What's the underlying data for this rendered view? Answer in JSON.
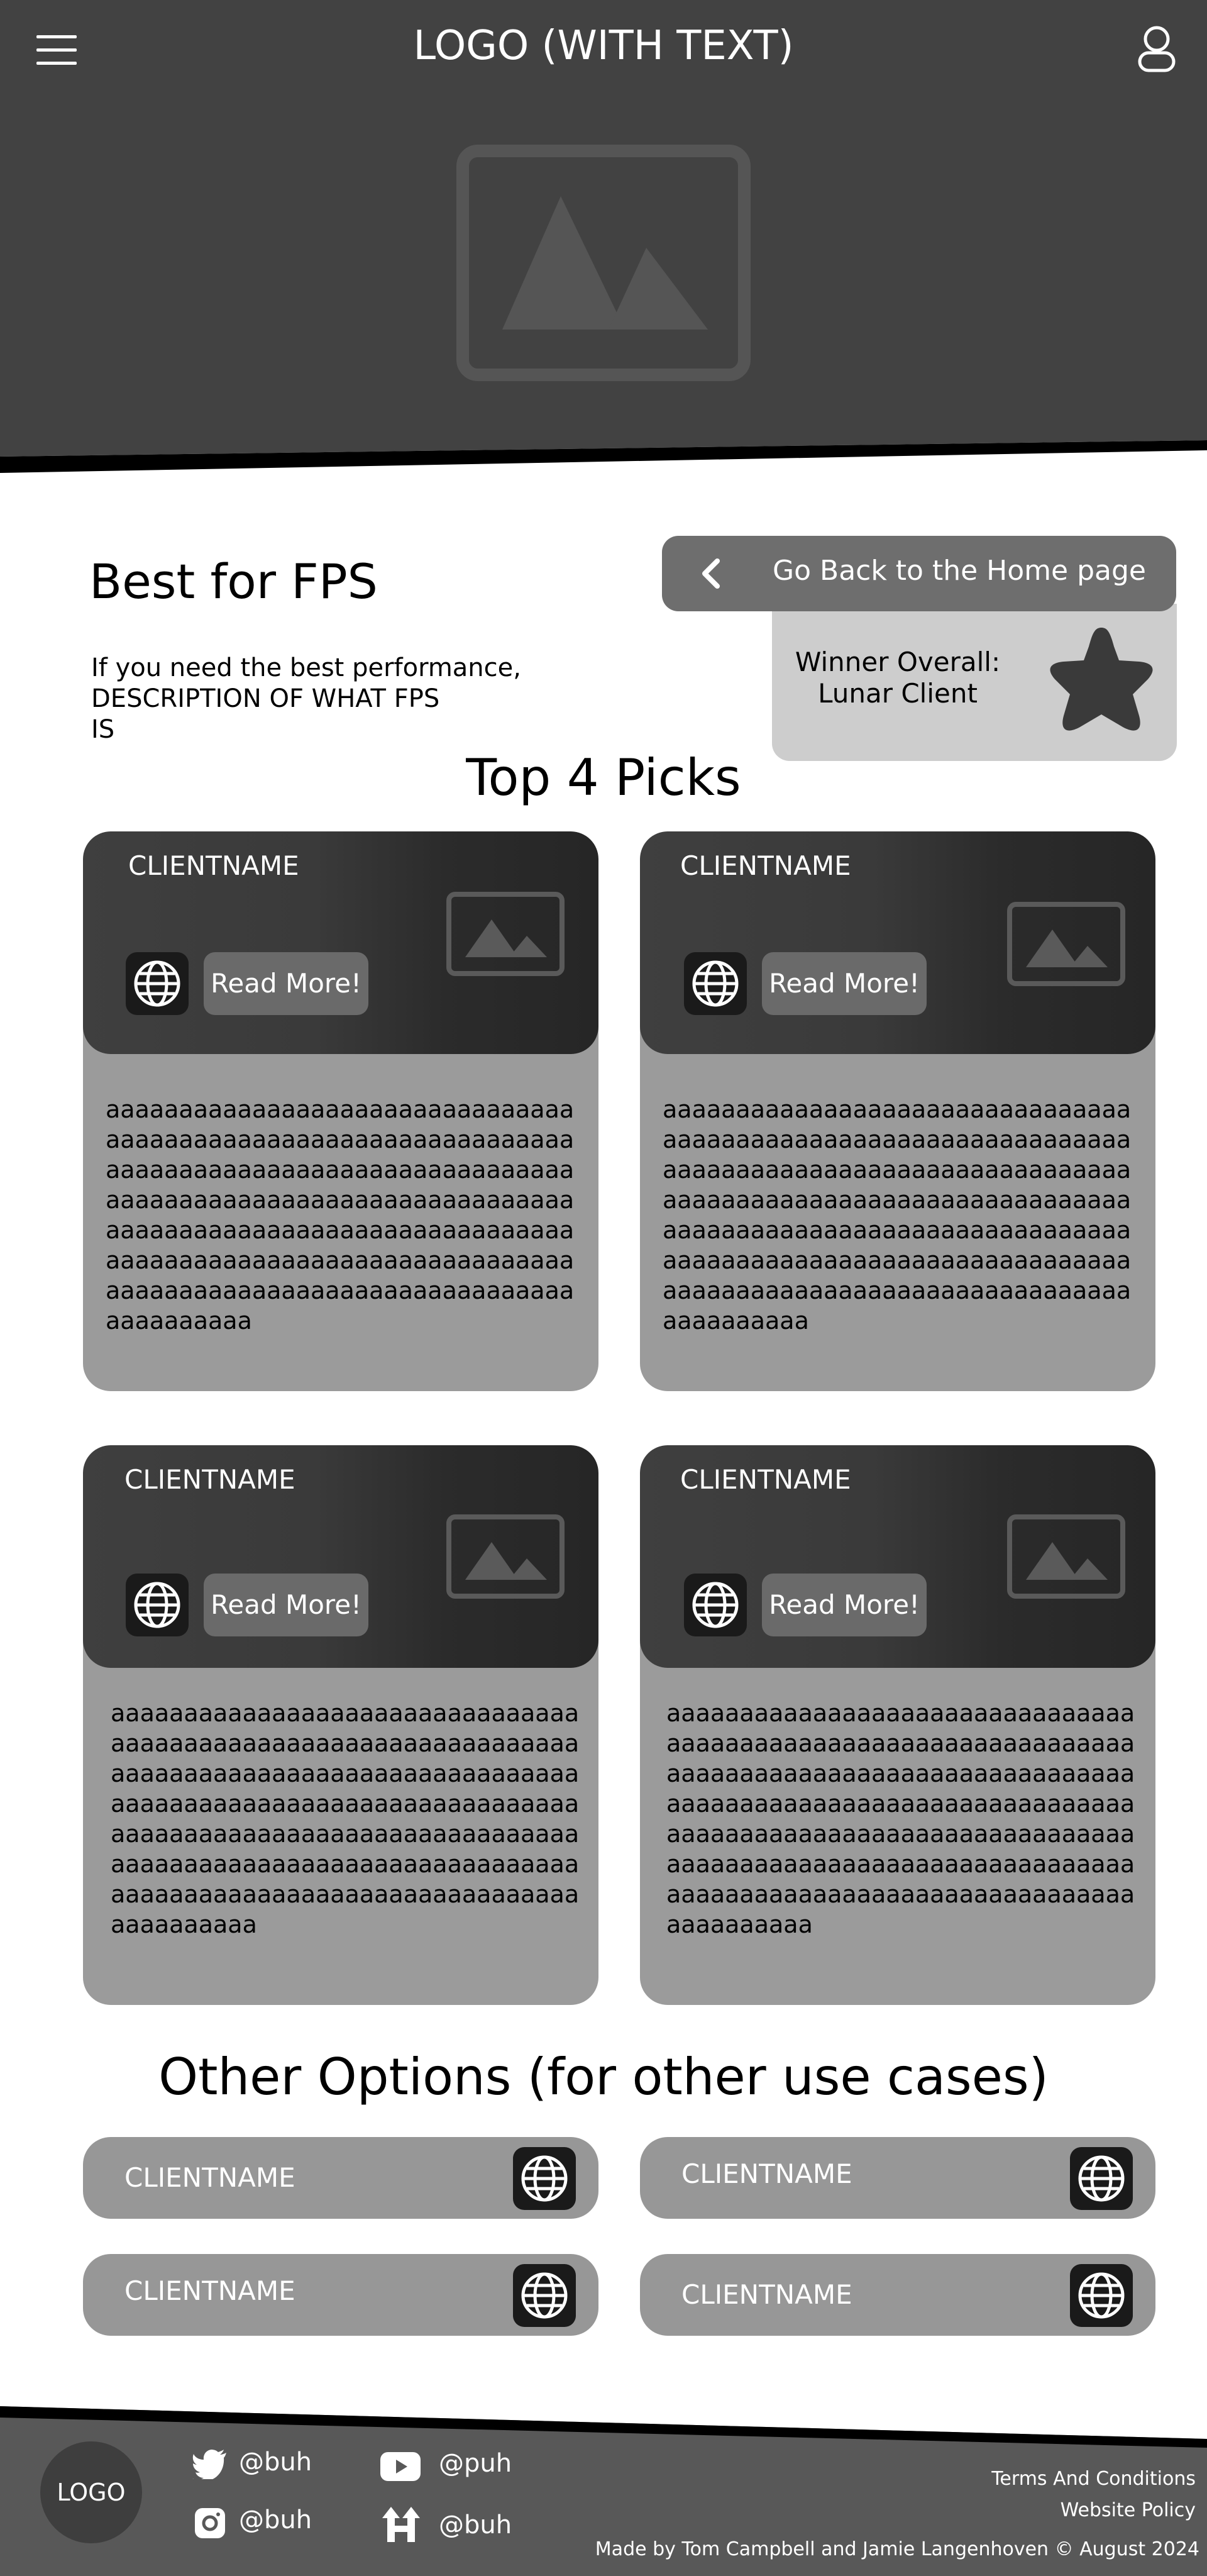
{
  "header": {
    "logo": "LOGO (WITH TEXT)",
    "menu_icon": "hamburger-menu-icon",
    "account_icon": "user-icon",
    "hero_image_icon": "image-placeholder-icon"
  },
  "intro": {
    "title": "Best for FPS",
    "description": "If you need the best performance,\nDESCRIPTION OF WHAT FPS\nIS",
    "back_button": "Go Back to the Home page",
    "back_icon": "chevron-left-icon",
    "winner_text": "Winner Overall:\nLunar Client",
    "winner_icon": "star-icon"
  },
  "top_picks": {
    "title": "Top 4 Picks",
    "cards": [
      {
        "name": "CLIENTNAME",
        "read_more": "Read More!",
        "body": "aaaaaaaaaaaaaaaaaaaaaaaaaaaaaaaaaaaaaaaaaaaaaaaaaaaaaaaaaaaaaaaaaaaaaaaaaaaaaaaaaaaaaaaaaaaaaaaaaaaaaaaaaaaaaaaaaaaaaaaaaaaaaaaaaaaaaaaaaaaaaaaaaaaaaaaaaaaaaaaaaaaaaaaaaaaaaaaaaaaaaaaaaaaaaaaaaaaaaaaaaaaaaaaaaaaaaaaaaaaaaaaaaaaaaaaaaa"
      },
      {
        "name": "CLIENTNAME",
        "read_more": "Read More!",
        "body": "aaaaaaaaaaaaaaaaaaaaaaaaaaaaaaaaaaaaaaaaaaaaaaaaaaaaaaaaaaaaaaaaaaaaaaaaaaaaaaaaaaaaaaaaaaaaaaaaaaaaaaaaaaaaaaaaaaaaaaaaaaaaaaaaaaaaaaaaaaaaaaaaaaaaaaaaaaaaaaaaaaaaaaaaaaaaaaaaaaaaaaaaaaaaaaaaaaaaaaaaaaaaaaaaaaaaaaaaaaaaaaaaaaaaaaaaaa"
      },
      {
        "name": "CLIENTNAME",
        "read_more": "Read More!",
        "body": "aaaaaaaaaaaaaaaaaaaaaaaaaaaaaaaaaaaaaaaaaaaaaaaaaaaaaaaaaaaaaaaaaaaaaaaaaaaaaaaaaaaaaaaaaaaaaaaaaaaaaaaaaaaaaaaaaaaaaaaaaaaaaaaaaaaaaaaaaaaaaaaaaaaaaaaaaaaaaaaaaaaaaaaaaaaaaaaaaaaaaaaaaaaaaaaaaaaaaaaaaaaaaaaaaaaaaaaaaaaaaaaaaaaaaaaaaa"
      },
      {
        "name": "CLIENTNAME",
        "read_more": "Read More!",
        "body": "aaaaaaaaaaaaaaaaaaaaaaaaaaaaaaaaaaaaaaaaaaaaaaaaaaaaaaaaaaaaaaaaaaaaaaaaaaaaaaaaaaaaaaaaaaaaaaaaaaaaaaaaaaaaaaaaaaaaaaaaaaaaaaaaaaaaaaaaaaaaaaaaaaaaaaaaaaaaaaaaaaaaaaaaaaaaaaaaaaaaaaaaaaaaaaaaaaaaaaaaaaaaaaaaaaaaaaaaaaaaaaaaaaaaaaaaaa"
      }
    ]
  },
  "other_options": {
    "title": "Other Options (for other use cases)",
    "items": [
      {
        "name": "CLIENTNAME"
      },
      {
        "name": "CLIENTNAME"
      },
      {
        "name": "CLIENTNAME"
      },
      {
        "name": "CLIENTNAME"
      }
    ]
  },
  "footer": {
    "logo": "LOGO",
    "socials": [
      {
        "icon": "twitter-icon",
        "handle": "@buh"
      },
      {
        "icon": "youtube-icon",
        "handle": "@puh"
      },
      {
        "icon": "instagram-icon",
        "handle": "@buh"
      },
      {
        "icon": "linktree-icon",
        "handle": "@buh"
      }
    ],
    "terms": "Terms And Conditions",
    "policy": "Website Policy",
    "credits": "Made by Tom Campbell and Jamie Langenhoven © August 2024"
  }
}
